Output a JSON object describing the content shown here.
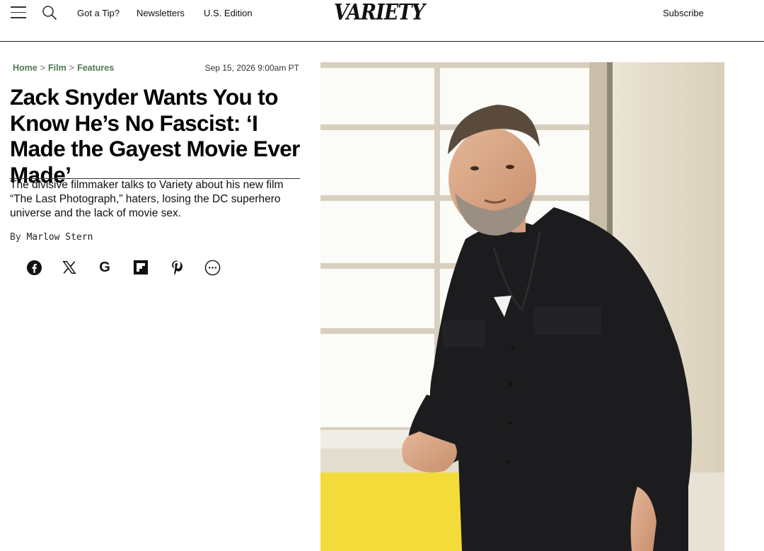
{
  "header": {
    "nav": [
      "Got a Tip?",
      "Newsletters",
      "U.S. Edition"
    ],
    "logo": "VARIETY",
    "subscribe": "Subscribe"
  },
  "breadcrumb": [
    "Home",
    "Film",
    "Features"
  ],
  "timestamp": "Sep 15, 2026 9:00am PT",
  "headline": "Zack Snyder Wants You to Know He’s No Fascist: ‘I Made the Gayest Movie Ever Made’",
  "dek": "The divisive filmmaker talks to Variety about his new film “The Last Photograph,” haters, losing the DC superhero universe and the lack of movie sex.",
  "byline": {
    "prefix": "By",
    "author": "Marlow Stern"
  },
  "share_icons": [
    "facebook-icon",
    "x-icon",
    "google-icon",
    "flipboard-icon",
    "pinterest-icon",
    "more-icon"
  ],
  "colors": {
    "breadcrumb": "#4f7a55",
    "text": "#000000",
    "photo_wall": "#f2efe8",
    "photo_yellow": "#f3dc3a",
    "shirt": "#1c1c1e"
  }
}
